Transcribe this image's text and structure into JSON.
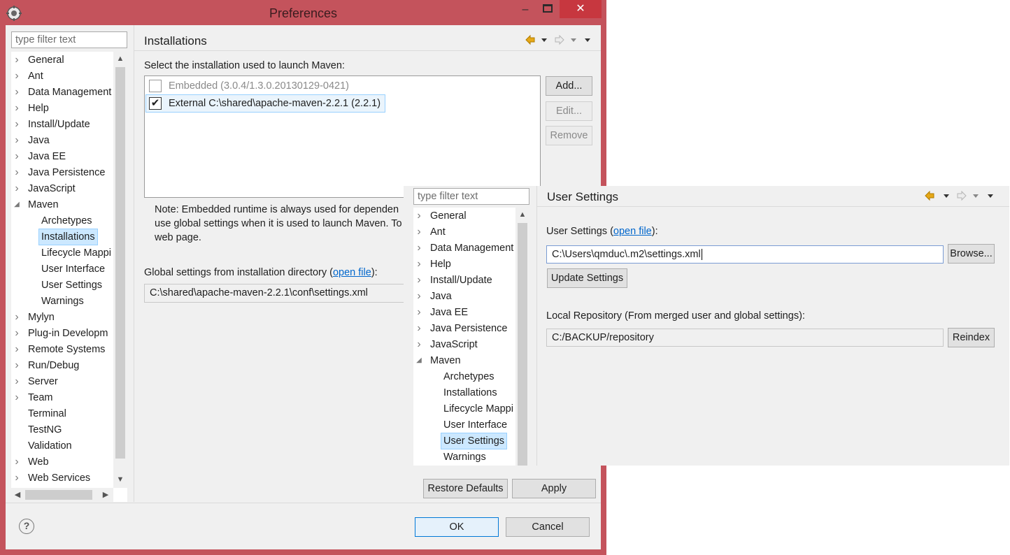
{
  "window": {
    "title": "Preferences",
    "controls": {
      "minimize": "–",
      "maximize": "□",
      "close": "✕"
    }
  },
  "filter": {
    "placeholder": "type filter text"
  },
  "tree_main": {
    "items": [
      {
        "label": "General",
        "expandable": true
      },
      {
        "label": "Ant",
        "expandable": true
      },
      {
        "label": "Data Management",
        "expandable": true
      },
      {
        "label": "Help",
        "expandable": true
      },
      {
        "label": "Install/Update",
        "expandable": true
      },
      {
        "label": "Java",
        "expandable": true
      },
      {
        "label": "Java EE",
        "expandable": true
      },
      {
        "label": "Java Persistence",
        "expandable": true
      },
      {
        "label": "JavaScript",
        "expandable": true
      },
      {
        "label": "Maven",
        "expandable": true,
        "expanded": true
      },
      {
        "label": "Archetypes",
        "child": true
      },
      {
        "label": "Installations",
        "child": true,
        "selected": true
      },
      {
        "label": "Lifecycle Mappi",
        "child": true
      },
      {
        "label": "User Interface",
        "child": true
      },
      {
        "label": "User Settings",
        "child": true
      },
      {
        "label": "Warnings",
        "child": true
      },
      {
        "label": "Mylyn",
        "expandable": true
      },
      {
        "label": "Plug-in Developm",
        "expandable": true
      },
      {
        "label": "Remote Systems",
        "expandable": true
      },
      {
        "label": "Run/Debug",
        "expandable": true
      },
      {
        "label": "Server",
        "expandable": true
      },
      {
        "label": "Team",
        "expandable": true
      },
      {
        "label": "Terminal"
      },
      {
        "label": "TestNG"
      },
      {
        "label": "Validation"
      },
      {
        "label": "Web",
        "expandable": true
      },
      {
        "label": "Web Services",
        "expandable": true
      }
    ]
  },
  "installations": {
    "heading": "Installations",
    "select_label": "Select the installation used to launch Maven:",
    "list": [
      {
        "label": "Embedded (3.0.4/1.3.0.20130129-0421)",
        "checked": false,
        "disabled": true
      },
      {
        "label": "External C:\\shared\\apache-maven-2.2.1 (2.2.1)",
        "checked": true,
        "selected": true
      }
    ],
    "buttons": {
      "add": "Add...",
      "edit": "Edit...",
      "remove": "Remove"
    },
    "note_lines": [
      "Note: Embedded runtime is always used for dependen",
      "use global settings when it is used to launch Maven. To",
      "web page."
    ],
    "global_label": "Global settings from installation directory (",
    "global_link": "open file",
    "global_label_end": "):",
    "global_path": "C:\\shared\\apache-maven-2.2.1\\conf\\settings.xml",
    "restore_defaults": "Restore Defaults",
    "apply": "Apply"
  },
  "footer": {
    "ok": "OK",
    "cancel": "Cancel",
    "help": "?"
  },
  "overlay": {
    "filter_placeholder": "type filter text",
    "tree": {
      "items": [
        {
          "label": "General",
          "expandable": true
        },
        {
          "label": "Ant",
          "expandable": true
        },
        {
          "label": "Data Management",
          "expandable": true
        },
        {
          "label": "Help",
          "expandable": true
        },
        {
          "label": "Install/Update",
          "expandable": true
        },
        {
          "label": "Java",
          "expandable": true
        },
        {
          "label": "Java EE",
          "expandable": true
        },
        {
          "label": "Java Persistence",
          "expandable": true
        },
        {
          "label": "JavaScript",
          "expandable": true
        },
        {
          "label": "Maven",
          "expandable": true,
          "expanded": true
        },
        {
          "label": "Archetypes",
          "child": true
        },
        {
          "label": "Installations",
          "child": true
        },
        {
          "label": "Lifecycle Mappi",
          "child": true
        },
        {
          "label": "User Interface",
          "child": true
        },
        {
          "label": "User Settings",
          "child": true,
          "selected": true
        },
        {
          "label": "Warnings",
          "child": true
        }
      ]
    },
    "heading": "User Settings",
    "user_settings_label": "User Settings (",
    "user_settings_link": "open file",
    "user_settings_label_end": "):",
    "user_settings_path": "C:\\Users\\qmduc\\.m2\\settings.xml",
    "browse": "Browse...",
    "update_settings": "Update Settings",
    "local_repo_label": "Local Repository (From merged user and global settings):",
    "local_repo_path": "C:/BACKUP/repository",
    "reindex": "Reindex"
  },
  "colors": {
    "title_bar": "#c4535c",
    "selection": "#cce8ff",
    "link": "#0066cc",
    "back_arrow": "#e6a817"
  }
}
